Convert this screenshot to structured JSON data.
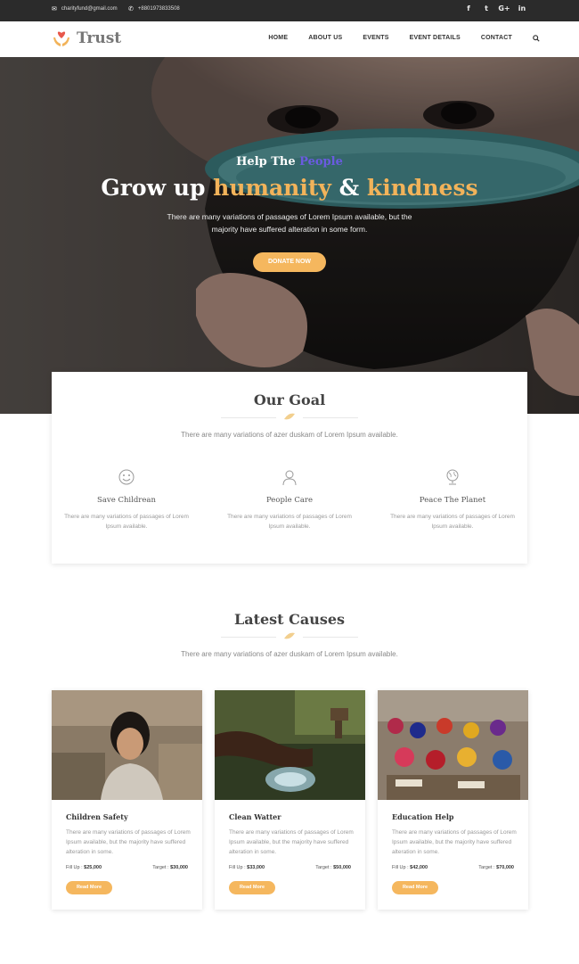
{
  "topbar": {
    "email": "charityfund@gmail.com",
    "phone": "+8801973833508",
    "social": [
      "f",
      "t",
      "G+",
      "in"
    ]
  },
  "brand": {
    "name": "Trust",
    "accent": "#e8584b"
  },
  "nav": {
    "items": [
      "HOME",
      "ABOUT US",
      "EVENTS",
      "EVENT DETAILS",
      "CONTACT"
    ],
    "search_icon": "search-icon"
  },
  "hero": {
    "subtitle_prefix": "Help The ",
    "subtitle_accent": "People",
    "title_a": "Grow up ",
    "title_b": "humanity",
    "title_c": " & ",
    "title_d": "kindness",
    "description": "There are many variations of passages of Lorem Ipsum available, but the majority have suffered alteration in some form.",
    "cta": "DONATE NOW"
  },
  "goal": {
    "title": "Our Goal",
    "subtitle": "There are many variations of azer duskam of Lorem Ipsum available.",
    "items": [
      {
        "icon": "smiley-icon",
        "title": "Save Childrean",
        "text": "There are many variations of passages of Lorem Ipsum available."
      },
      {
        "icon": "person-icon",
        "title": "People Care",
        "text": "There are many variations of passages of Lorem Ipsum available."
      },
      {
        "icon": "globe-icon",
        "title": "Peace The Planet",
        "text": "There are many variations of passages of Lorem Ipsum available."
      }
    ]
  },
  "causes": {
    "title": "Latest Causes",
    "subtitle": "There are many variations of azer duskam of Lorem Ipsum available.",
    "cards": [
      {
        "title": "Children Safety",
        "text": "There are many variations of passages of Lorem Ipsum available, but the majority have suffered alteration in some.",
        "fill_label": "Fill Up :",
        "fill": "$25,000",
        "target_label": "Target :",
        "target": "$30,000",
        "button": "Read More"
      },
      {
        "title": "Clean Watter",
        "text": "There are many variations of passages of Lorem Ipsum available, but the majority have suffered alteration in some.",
        "fill_label": "Fill Up :",
        "fill": "$33,000",
        "target_label": "Target :",
        "target": "$50,000",
        "button": "Read More"
      },
      {
        "title": "Education Help",
        "text": "There are many variations of passages of Lorem Ipsum available, but the majority have suffered alteration in some.",
        "fill_label": "Fill Up :",
        "fill": "$42,000",
        "target_label": "Target :",
        "target": "$70,000",
        "button": "Read More"
      }
    ]
  },
  "colors": {
    "accent": "#f5b75e",
    "topbar": "#2b2b2b",
    "purple": "#6a5be0"
  }
}
